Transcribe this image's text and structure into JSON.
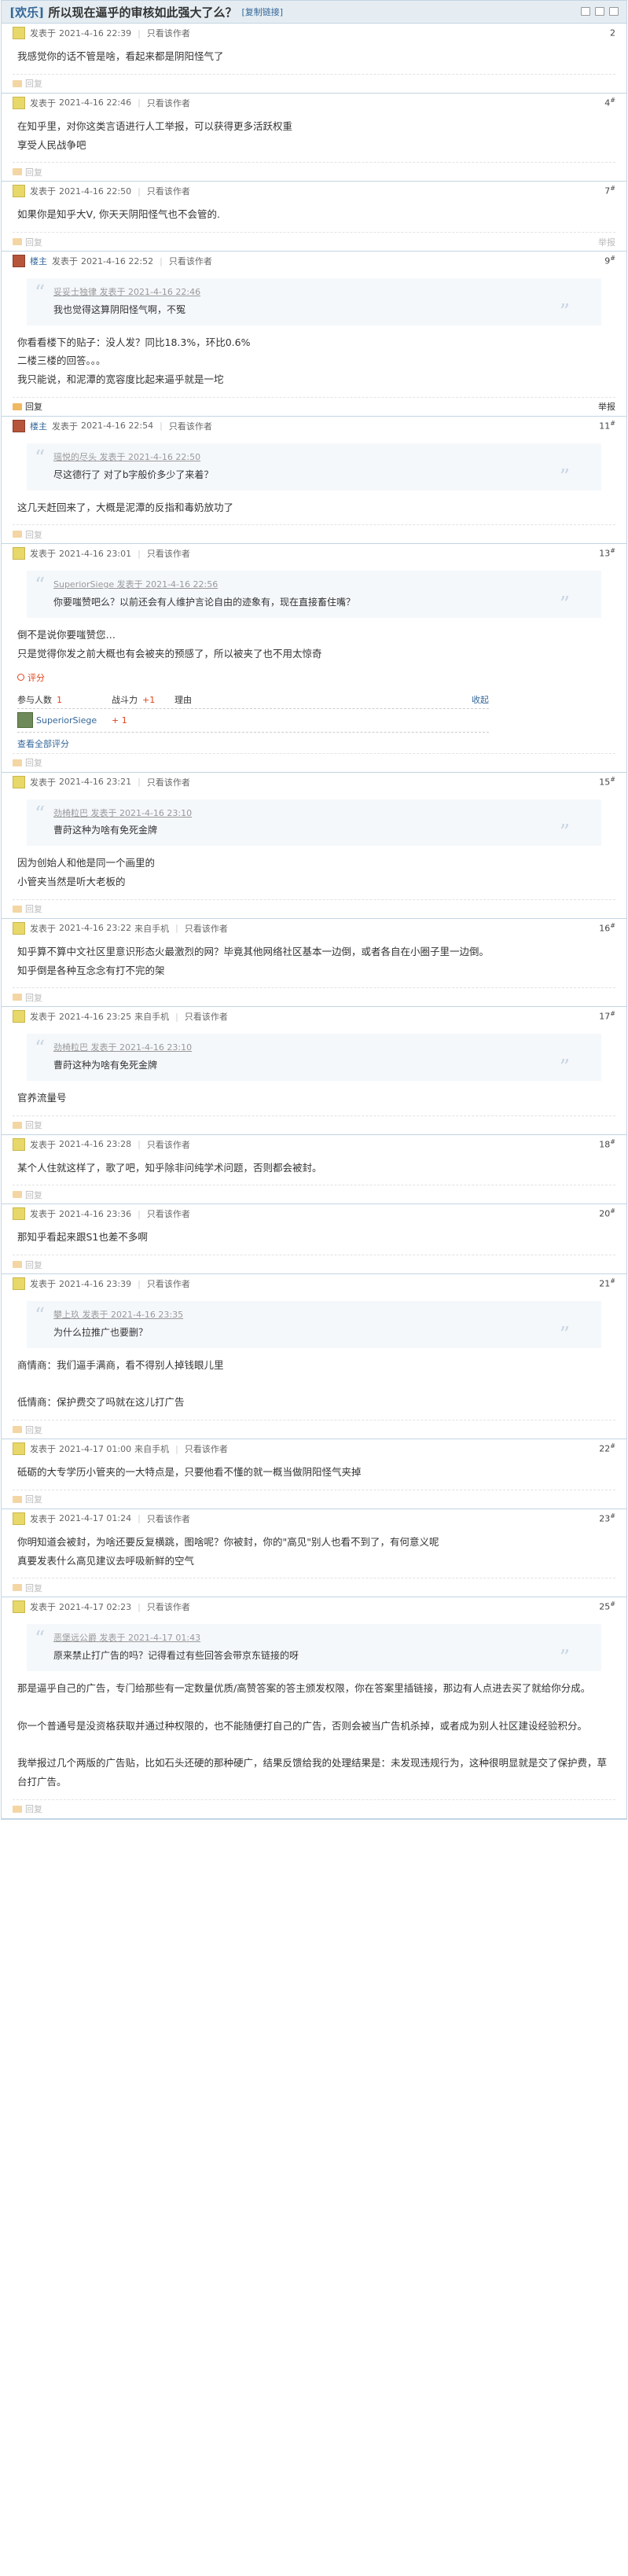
{
  "header": {
    "forum_tag": "[欢乐]",
    "title": "所以现在逼乎的审核如此强大了么？",
    "copy_link": "[复制链接]"
  },
  "posts": [
    {
      "author": "发表于",
      "time": "2021-4-16 22:39",
      "only": "只看该作者",
      "floor": "2",
      "floor_sup": "",
      "body": [
        "我感觉你的话不管是啥，看起来都是阴阳怪气了"
      ],
      "reply": "回复"
    },
    {
      "author": "发表于",
      "time": "2021-4-16 22:46",
      "only": "只看该作者",
      "floor": "4",
      "floor_sup": "#",
      "body": [
        "在知乎里，对你这类言语进行人工举报，可以获得更多活跃权重",
        "享受人民战争吧"
      ],
      "reply": "回复"
    },
    {
      "author": "发表于",
      "time": "2021-4-16 22:50",
      "only": "只看该作者",
      "floor": "7",
      "floor_sup": "#",
      "body": [
        "如果你是知乎大V, 你天天阴阳怪气也不会管的."
      ],
      "reply": "回复",
      "extra": "举报"
    },
    {
      "host": "楼主",
      "author": "发表于",
      "time": "2021-4-16 22:52",
      "only": "只看该作者",
      "floor": "9",
      "floor_sup": "#",
      "quote_src": "妥妥士独律 发表于 2021-4-16 22:46",
      "quote_text": "我也觉得这算阴阳怪气啊，不冤",
      "body": [
        "你看看楼下的贴子：没人发？同比18.3%，环比0.6%",
        "二楼三楼的回答。。。",
        "我只能说，和泥潭的宽容度比起来逼乎就是一坨"
      ],
      "reply": "回复",
      "extra": "举报"
    },
    {
      "host": "楼主",
      "author": "发表于",
      "time": "2021-4-16 22:54",
      "only": "只看该作者",
      "floor": "11",
      "floor_sup": "#",
      "quote_src": "瑶悦的尽头 发表于 2021-4-16 22:50",
      "quote_text": "尽这德行了 对了b字般价多少了来着？",
      "body": [
        "这几天赶回来了，大概是泥潭的反指和毒奶放功了"
      ],
      "reply": "回复"
    },
    {
      "author": "发表于",
      "time": "2021-4-16 23:01",
      "only": "只看该作者",
      "floor": "13",
      "floor_sup": "#",
      "quote_src": "SuperiorSiege 发表于 2021-4-16 22:56",
      "quote_text": "你要嗤赞吧么？以前还会有人维护言论自由的迹象有，现在直接畜住嘴？",
      "body": [
        "倒不是说你要嗤赞您…",
        "只是觉得你发之前大概也有会被夹的预感了，所以被夹了也不用太惊奇"
      ],
      "rate": {
        "link": "评分",
        "participants_label": "参与人数",
        "participants": "1",
        "points_label": "战斗力",
        "points": "+1",
        "reason_label": "理由",
        "collapse": "收起",
        "rater": "SuperiorSiege",
        "rater_points": "+ 1",
        "view_all": "查看全部评分"
      },
      "reply": "回复"
    },
    {
      "author": "发表于",
      "time": "2021-4-16 23:21",
      "only": "只看该作者",
      "floor": "15",
      "floor_sup": "#",
      "quote_src": "劲椅粒巴 发表于 2021-4-16 23:10",
      "quote_text": "曹莳这种为啥有免死金牌",
      "body": [
        "因为创始人和他是同一个画里的",
        "小管夹当然是听大老板的"
      ],
      "reply": "回复"
    },
    {
      "author": "发表于",
      "time": "2021-4-16 23:22",
      "device": "来自手机",
      "only": "只看该作者",
      "floor": "16",
      "floor_sup": "#",
      "body": [
        "知乎算不算中文社区里意识形态火最激烈的网？毕竟其他网络社区基本一边倒，或者各自在小圈子里一边倒。",
        "知乎倒是各种互念念有打不完的架"
      ],
      "reply": "回复"
    },
    {
      "author": "发表于",
      "time": "2021-4-16 23:25",
      "device": "来自手机",
      "only": "只看该作者",
      "floor": "17",
      "floor_sup": "#",
      "quote_src": "劲椅粒巴 发表于 2021-4-16 23:10",
      "quote_text": "曹莳这种为啥有免死金牌",
      "body": [
        "官养流量号"
      ],
      "reply": "回复"
    },
    {
      "author": "发表于",
      "time": "2021-4-16 23:28",
      "only": "只看该作者",
      "floor": "18",
      "floor_sup": "#",
      "body": [
        "某个人住就这样了，歌了吧，知乎除非问纯学术问题，否则都会被封。"
      ],
      "reply": "回复"
    },
    {
      "author": "发表于",
      "time": "2021-4-16 23:36",
      "only": "只看该作者",
      "floor": "20",
      "floor_sup": "#",
      "body": [
        "那知乎看起来跟S1也差不多啊"
      ],
      "reply": "回复"
    },
    {
      "author": "发表于",
      "time": "2021-4-16 23:39",
      "only": "只看该作者",
      "floor": "21",
      "floor_sup": "#",
      "quote_src": "攀上玖 发表于 2021-4-16 23:35",
      "quote_text": "为什么拉推广也要删？",
      "body": [
        "商情商：我们逼手满商，看不得别人掉钱眼儿里",
        "",
        "低情商：保护费交了吗就在这儿打广告"
      ],
      "reply": "回复"
    },
    {
      "author": "发表于",
      "time": "2021-4-17 01:00",
      "device": "来自手机",
      "only": "只看该作者",
      "floor": "22",
      "floor_sup": "#",
      "body": [
        "砥砺的大专学历小管夹的一大特点是，只要他看不懂的就一概当做阴阳怪气夹掉"
      ],
      "reply": "回复"
    },
    {
      "author": "发表于",
      "time": "2021-4-17 01:24",
      "only": "只看该作者",
      "floor": "23",
      "floor_sup": "#",
      "body": [
        "你明知道会被封，为啥还要反复横跳，图啥呢？你被封，你的\"高见\"别人也看不到了，有何意义呢",
        "真要发表什么高见建议去呼吸新鲜的空气"
      ],
      "reply": "回复"
    },
    {
      "author": "发表于",
      "time": "2021-4-17 02:23",
      "only": "只看该作者",
      "floor": "25",
      "floor_sup": "#",
      "quote_src": "恶堡远公爵 发表于 2021-4-17 01:43",
      "quote_text": "原来禁止打广告的吗？记得看过有些回答会带京东链接的呀",
      "body": [
        "那是逼乎自己的广告，专门给那些有一定数量优质/高赞答案的答主颁发权限，你在答案里插链接，那边有人点进去买了就给你分成。",
        "",
        "你一个普通号是没资格获取并通过种权限的，也不能随便打自己的广告，否则会被当广告机杀掉，或者成为别人社区建设经验积分。",
        "",
        "我举报过几个两版的广告贴，比如石头还硬的那种硬广，结果反馈给我的处理结果是：未发现违规行为，这种很明显就是交了保护费，草台打广告。"
      ],
      "reply": "回复"
    }
  ]
}
